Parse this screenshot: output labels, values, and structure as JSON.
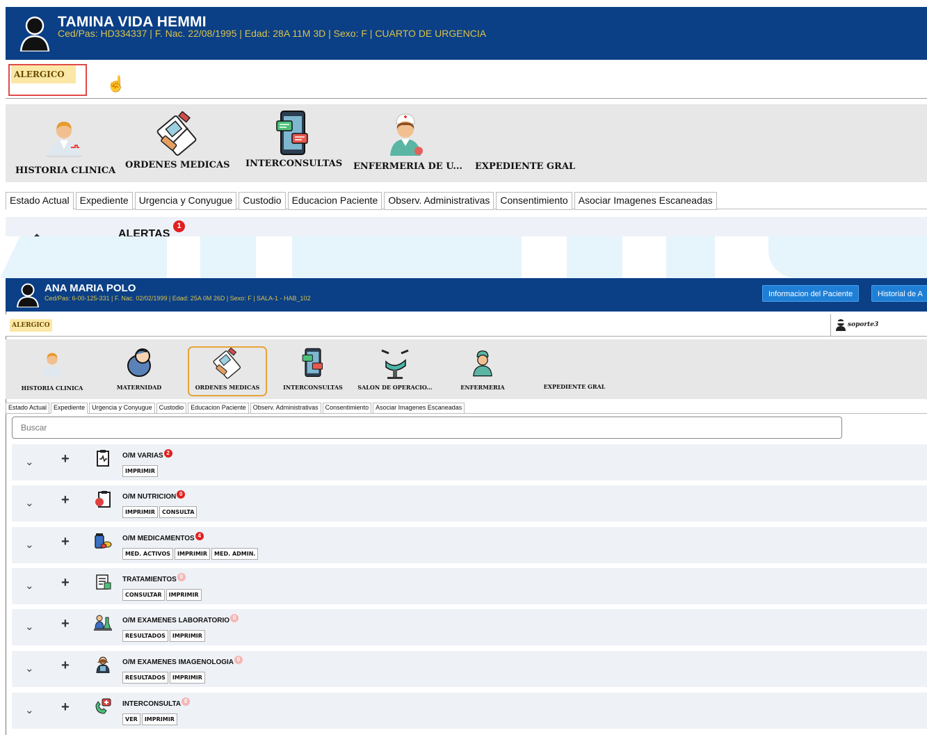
{
  "top": {
    "patient_name": "TAMINA VIDA HEMMI",
    "patient_info": "Ced/Pas: HD334337 | F. Nac. 22/08/1995 | Edad: 28A 11M 3D | Sexo: F  | CUARTO DE URGENCIA",
    "alergico": "ALERGICO",
    "tools": [
      "HISTORIA CLINICA",
      "ORDENES MEDICAS",
      "INTERCONSULTAS",
      "ENFERMERIA DE U...",
      "EXPEDIENTE GRAL"
    ],
    "tabs": [
      "Estado Actual",
      "Expediente",
      "Urgencia y Conyugue",
      "Custodio",
      "Educacion Paciente",
      "Observ. Administrativas",
      "Consentimiento",
      "Asociar Imagenes Escaneadas"
    ],
    "alertas": "ALERTAS",
    "alertas_count": "1"
  },
  "bottom": {
    "patient_name": "ANA MARIA POLO",
    "patient_info": "Ced/Pas: 6-00-125-331 | F. Nac. 02/02/1999 | Edad: 25A 0M 26D | Sexo: F  | SALA-1  - HAB_102",
    "header_buttons": [
      "Informacion del Paciente",
      "Historial de A"
    ],
    "alergico": "ALERGICO",
    "user": "soporte3",
    "tools": [
      "HISTORIA CLINICA",
      "MATERNIDAD",
      "ORDENES MEDICAS",
      "INTERCONSULTAS",
      "SALON DE OPERACIO...",
      "ENFERMERIA",
      "EXPEDIENTE GRAL"
    ],
    "tabs": [
      "Estado Actual",
      "Expediente",
      "Urgencia y Conyugue",
      "Custodio",
      "Educacion Paciente",
      "Observ. Administrativas",
      "Consentimiento",
      "Asociar Imagenes Escaneadas"
    ],
    "search_placeholder": "Buscar",
    "rows": [
      {
        "title": "O/M VARIAS",
        "badge": "2",
        "buttons": [
          "IMPRIMIR"
        ]
      },
      {
        "title": "O/M NUTRICION",
        "badge": "0",
        "buttons": [
          "IMPRIMIR",
          "CONSULTA"
        ]
      },
      {
        "title": "O/M MEDICAMENTOS",
        "badge": "4",
        "buttons": [
          "MED. ACTIVOS",
          "IMPRIMIR",
          "MED. ADMIN."
        ]
      },
      {
        "title": "TRATAMIENTOS",
        "badge": "0",
        "buttons": [
          "CONSULTAR",
          "IMPRIMIR"
        ]
      },
      {
        "title": "O/M EXAMENES LABORATORIO",
        "badge": "0",
        "buttons": [
          "RESULTADOS",
          "IMPRIMIR"
        ]
      },
      {
        "title": "O/M EXAMENES IMAGENOLOGIA",
        "badge": "0",
        "buttons": [
          "RESULTADOS",
          "IMPRIMIR"
        ]
      },
      {
        "title": "INTERCONSULTA",
        "badge": "0",
        "buttons": [
          "VER",
          "IMPRIMIR"
        ]
      }
    ]
  },
  "colors": {
    "header_bg": "#0b3f86",
    "info_text": "#d9c34a",
    "alergico_bg": "#fbe8a6",
    "highlight_red": "#e04848",
    "selected_orange": "#e8a437",
    "badge_red": "#e02020",
    "action_blue": "#1f7fd6"
  }
}
